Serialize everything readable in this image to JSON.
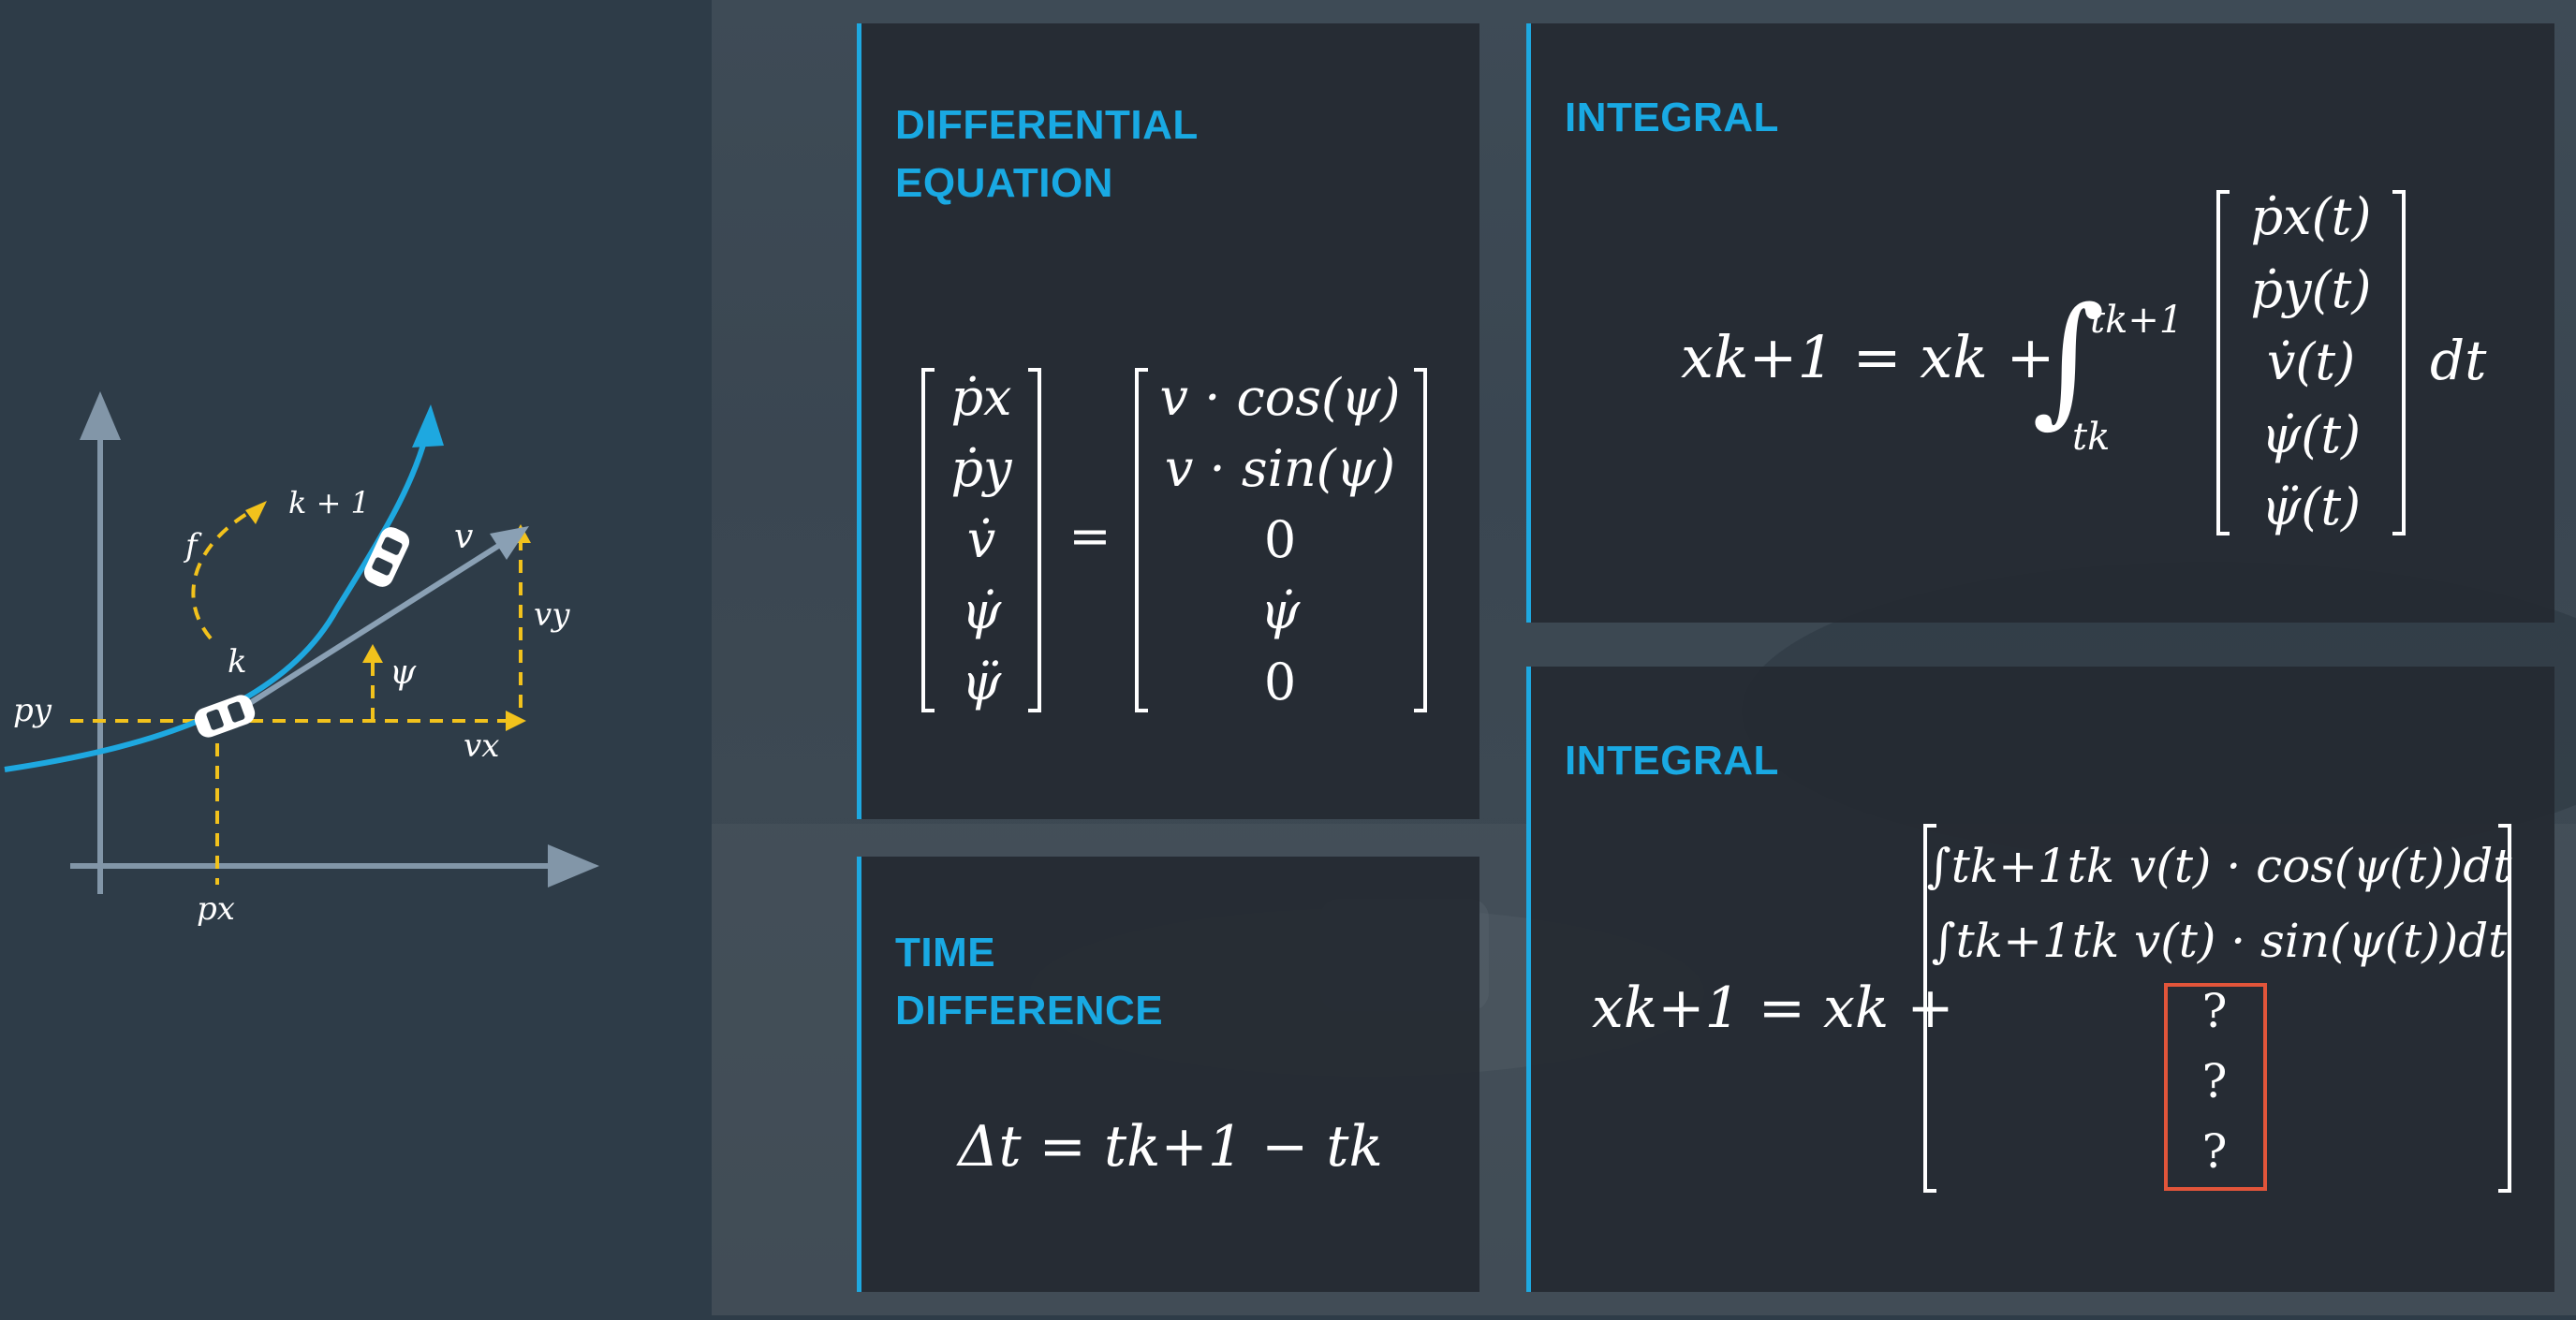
{
  "diagram": {
    "k_next_label": "k + 1",
    "f_label": "f",
    "v_label": "v",
    "vy_label": "vy",
    "k_label": "k",
    "psi_label": "ψ",
    "py_label": "py",
    "vx_label": "vx",
    "px_label": "px",
    "colors": {
      "path": "#1ea8e0",
      "dashed": "#f2c21c",
      "axis": "#8296a8",
      "velocity": "#8aa0b4"
    }
  },
  "cards": {
    "differential": {
      "title_line1": "DIFFERENTIAL",
      "title_line2": "EQUATION",
      "lhs": [
        "ṗx",
        "ṗy",
        "v̇",
        "ψ̇",
        "ψ̈"
      ],
      "rhs": [
        "v · cos(ψ)",
        "v · sin(ψ)",
        "0",
        "ψ̇",
        "0"
      ],
      "equals": "="
    },
    "integral_top": {
      "title": "INTEGRAL",
      "lhs": "xk+1 = xk +",
      "upper_limit": "tk+1",
      "lower_limit": "tk",
      "vector": [
        "ṗx(t)",
        "ṗy(t)",
        "v̇(t)",
        "ψ̇(t)",
        "ψ̈(t)"
      ],
      "dt": "dt"
    },
    "time_difference": {
      "title_line1": "TIME",
      "title_line2": "DIFFERENCE",
      "equation": "Δt = tk+1 − tk"
    },
    "integral_bottom": {
      "title": "INTEGRAL",
      "lhs": "xk+1 = xk +",
      "row1": "∫tk+1tk v(t) · cos(ψ(t))dt",
      "row2": "∫tk+1tk v(t) · sin(ψ(t))dt",
      "unknowns": [
        "?",
        "?",
        "?"
      ],
      "highlight_color": "#e2553a"
    }
  },
  "accent_color": "#19a9e3"
}
